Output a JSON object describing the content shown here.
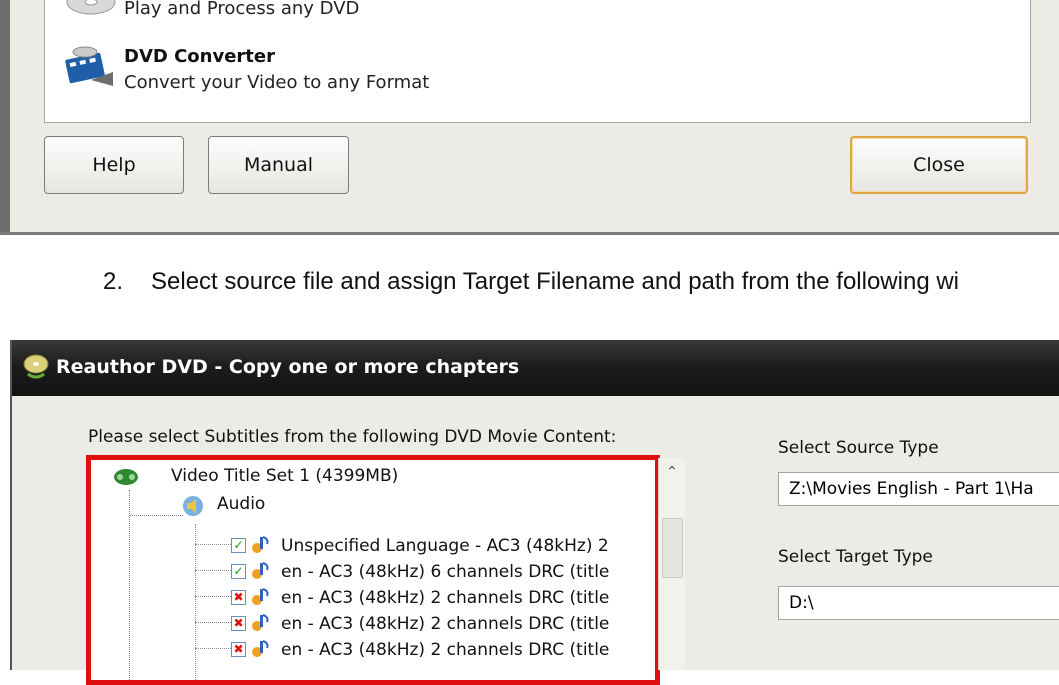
{
  "menu": {
    "items": [
      {
        "title": "",
        "subtitle": "Play and Process any DVD"
      },
      {
        "title": "DVD Converter",
        "subtitle": "Convert your Video to any Format"
      }
    ]
  },
  "buttons": {
    "help": "Help",
    "manual": "Manual",
    "close": "Close"
  },
  "instruction": {
    "number": "2.",
    "text": "Select source file and assign Target Filename and path from the following wi"
  },
  "window": {
    "title": "Reauthor DVD - Copy one or more chapters",
    "subtitles_prompt": "Please select Subtitles from the following DVD Movie Content:",
    "tree": {
      "root": "Video Title Set 1 (4399MB)",
      "audio_node": "Audio",
      "tracks": [
        {
          "label": "Unspecified Language - AC3 (48kHz) 2",
          "checked": true
        },
        {
          "label": "en - AC3 (48kHz) 6 channels DRC (title",
          "checked": true
        },
        {
          "label": "en - AC3 (48kHz) 2 channels DRC (title",
          "checked": false
        },
        {
          "label": "en - AC3 (48kHz) 2 channels DRC (title",
          "checked": false
        },
        {
          "label": "en - AC3 (48kHz) 2 channels DRC (title",
          "checked": false
        }
      ]
    },
    "source": {
      "label": "Select Source Type",
      "value": "Z:\\Movies English - Part 1\\Ha"
    },
    "target": {
      "label": "Select Target Type",
      "value": "D:\\"
    }
  },
  "colors": {
    "highlight_border": "#e00f0f",
    "titlebar": "#1d1d1d",
    "close_focus": "#e0a545"
  }
}
